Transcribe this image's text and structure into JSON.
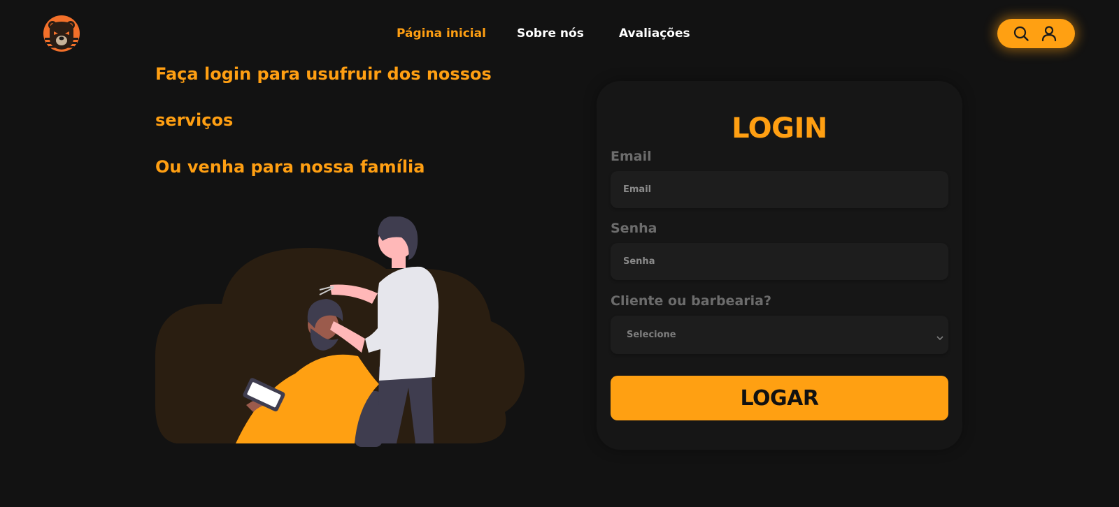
{
  "header": {
    "logo_icon": "bear-logo-icon",
    "nav": [
      {
        "label": "Página inicial",
        "active": true
      },
      {
        "label": "Sobre nós",
        "active": false
      },
      {
        "label": "Avaliações",
        "active": false
      }
    ],
    "actions": {
      "search_icon": "search-icon",
      "user_icon": "user-icon"
    }
  },
  "hero": {
    "line1": "Faça login para usufruir dos nossos",
    "line2": "serviços",
    "line3": "Ou venha para nossa família",
    "illustration": "barber-cutting-hair-illustration"
  },
  "login": {
    "title": "LOGIN",
    "email_label": "Email",
    "email_placeholder": "Email",
    "password_label": "Senha",
    "password_placeholder": "Senha",
    "type_label": "Cliente ou barbearia?",
    "type_selected": "Selecione",
    "submit_label": "LOGAR"
  },
  "colors": {
    "accent": "#ffa012",
    "background": "#121212",
    "card": "#161616",
    "field": "#1d1d1d",
    "label": "#6c6c6c"
  }
}
